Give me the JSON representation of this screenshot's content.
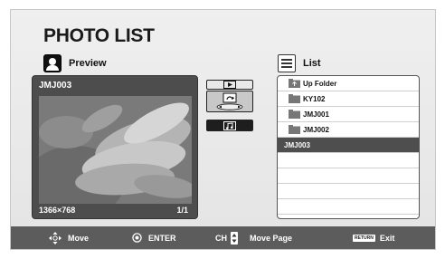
{
  "title": "PHOTO LIST",
  "preview": {
    "label": "Preview",
    "icon": "preview-icon",
    "file": "JMJ003",
    "resolution": "1366×768",
    "page": "1/1"
  },
  "side_buttons": [
    {
      "name": "slideshow",
      "icon": "play-icon"
    },
    {
      "name": "rotate",
      "icon": "rotate-icon"
    },
    {
      "name": "music",
      "icon": "music-note-icon"
    }
  ],
  "list": {
    "label": "List",
    "icon": "list-icon",
    "rows": [
      {
        "label": "Up Folder",
        "type": "up-folder"
      },
      {
        "label": "KY102",
        "type": "folder"
      },
      {
        "label": "JMJ001",
        "type": "folder"
      },
      {
        "label": "JMJ002",
        "type": "folder"
      },
      {
        "label": "JMJ003",
        "type": "file",
        "selected": true
      },
      {
        "label": "",
        "type": "empty"
      },
      {
        "label": "",
        "type": "empty"
      },
      {
        "label": "",
        "type": "empty"
      },
      {
        "label": "",
        "type": "empty"
      }
    ]
  },
  "footer": {
    "move": "Move",
    "enter": "ENTER",
    "ch": "CH",
    "move_page": "Move Page",
    "return_badge": "RETURN",
    "exit": "Exit"
  },
  "colors": {
    "panel_dark": "#4d4d4d",
    "selected_row": "#4e4e4e",
    "footer": "#5c5c5c"
  }
}
